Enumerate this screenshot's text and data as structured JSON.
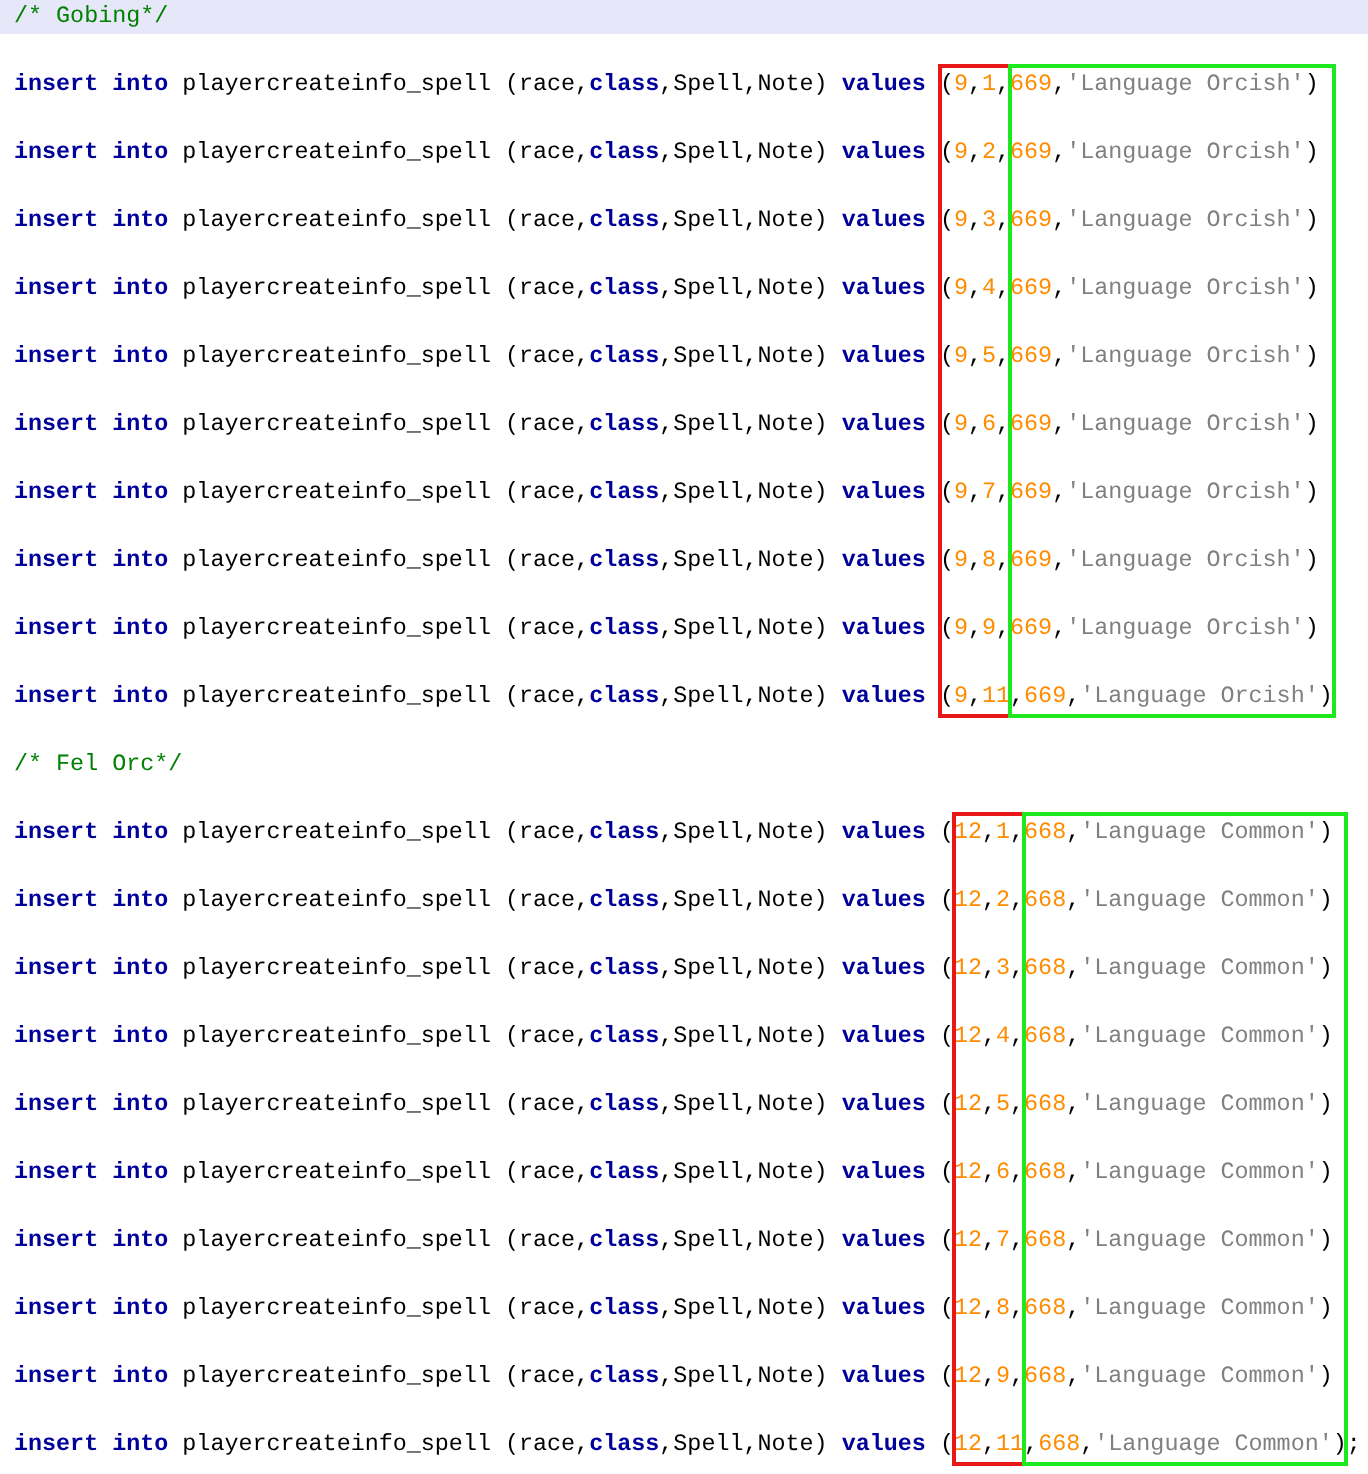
{
  "sections": [
    {
      "lines": [
        {
          "kind": "comment",
          "highlighted": true,
          "text": "/* Gobing*/"
        },
        {
          "kind": "statement",
          "highlighted": false,
          "tokens": [
            {
              "kind": "keyword",
              "text": "insert into"
            },
            {
              "kind": "plain",
              "text": " playercreateinfo_spell (race,"
            },
            {
              "kind": "keyword",
              "text": "class"
            },
            {
              "kind": "plain",
              "text": ",Spell,Note) "
            },
            {
              "kind": "keyword",
              "text": "values"
            },
            {
              "kind": "plain",
              "text": " ("
            },
            {
              "kind": "number",
              "text": "9"
            },
            {
              "kind": "plain",
              "text": ","
            },
            {
              "kind": "number",
              "text": "1"
            },
            {
              "kind": "plain",
              "text": ","
            },
            {
              "kind": "number",
              "text": "669"
            },
            {
              "kind": "plain",
              "text": ","
            },
            {
              "kind": "string",
              "text": "'Language Orcish'"
            },
            {
              "kind": "plain",
              "text": ")"
            }
          ]
        },
        {
          "kind": "statement",
          "highlighted": false,
          "tokens": [
            {
              "kind": "keyword",
              "text": "insert into"
            },
            {
              "kind": "plain",
              "text": " playercreateinfo_spell (race,"
            },
            {
              "kind": "keyword",
              "text": "class"
            },
            {
              "kind": "plain",
              "text": ",Spell,Note) "
            },
            {
              "kind": "keyword",
              "text": "values"
            },
            {
              "kind": "plain",
              "text": " ("
            },
            {
              "kind": "number",
              "text": "9"
            },
            {
              "kind": "plain",
              "text": ","
            },
            {
              "kind": "number",
              "text": "2"
            },
            {
              "kind": "plain",
              "text": ","
            },
            {
              "kind": "number",
              "text": "669"
            },
            {
              "kind": "plain",
              "text": ","
            },
            {
              "kind": "string",
              "text": "'Language Orcish'"
            },
            {
              "kind": "plain",
              "text": ")"
            }
          ]
        },
        {
          "kind": "statement",
          "highlighted": false,
          "tokens": [
            {
              "kind": "keyword",
              "text": "insert into"
            },
            {
              "kind": "plain",
              "text": " playercreateinfo_spell (race,"
            },
            {
              "kind": "keyword",
              "text": "class"
            },
            {
              "kind": "plain",
              "text": ",Spell,Note) "
            },
            {
              "kind": "keyword",
              "text": "values"
            },
            {
              "kind": "plain",
              "text": " ("
            },
            {
              "kind": "number",
              "text": "9"
            },
            {
              "kind": "plain",
              "text": ","
            },
            {
              "kind": "number",
              "text": "3"
            },
            {
              "kind": "plain",
              "text": ","
            },
            {
              "kind": "number",
              "text": "669"
            },
            {
              "kind": "plain",
              "text": ","
            },
            {
              "kind": "string",
              "text": "'Language Orcish'"
            },
            {
              "kind": "plain",
              "text": ")"
            }
          ]
        },
        {
          "kind": "statement",
          "highlighted": false,
          "tokens": [
            {
              "kind": "keyword",
              "text": "insert into"
            },
            {
              "kind": "plain",
              "text": " playercreateinfo_spell (race,"
            },
            {
              "kind": "keyword",
              "text": "class"
            },
            {
              "kind": "plain",
              "text": ",Spell,Note) "
            },
            {
              "kind": "keyword",
              "text": "values"
            },
            {
              "kind": "plain",
              "text": " ("
            },
            {
              "kind": "number",
              "text": "9"
            },
            {
              "kind": "plain",
              "text": ","
            },
            {
              "kind": "number",
              "text": "4"
            },
            {
              "kind": "plain",
              "text": ","
            },
            {
              "kind": "number",
              "text": "669"
            },
            {
              "kind": "plain",
              "text": ","
            },
            {
              "kind": "string",
              "text": "'Language Orcish'"
            },
            {
              "kind": "plain",
              "text": ")"
            }
          ]
        },
        {
          "kind": "statement",
          "highlighted": false,
          "tokens": [
            {
              "kind": "keyword",
              "text": "insert into"
            },
            {
              "kind": "plain",
              "text": " playercreateinfo_spell (race,"
            },
            {
              "kind": "keyword",
              "text": "class"
            },
            {
              "kind": "plain",
              "text": ",Spell,Note) "
            },
            {
              "kind": "keyword",
              "text": "values"
            },
            {
              "kind": "plain",
              "text": " ("
            },
            {
              "kind": "number",
              "text": "9"
            },
            {
              "kind": "plain",
              "text": ","
            },
            {
              "kind": "number",
              "text": "5"
            },
            {
              "kind": "plain",
              "text": ","
            },
            {
              "kind": "number",
              "text": "669"
            },
            {
              "kind": "plain",
              "text": ","
            },
            {
              "kind": "string",
              "text": "'Language Orcish'"
            },
            {
              "kind": "plain",
              "text": ")"
            }
          ]
        },
        {
          "kind": "statement",
          "highlighted": false,
          "tokens": [
            {
              "kind": "keyword",
              "text": "insert into"
            },
            {
              "kind": "plain",
              "text": " playercreateinfo_spell (race,"
            },
            {
              "kind": "keyword",
              "text": "class"
            },
            {
              "kind": "plain",
              "text": ",Spell,Note) "
            },
            {
              "kind": "keyword",
              "text": "values"
            },
            {
              "kind": "plain",
              "text": " ("
            },
            {
              "kind": "number",
              "text": "9"
            },
            {
              "kind": "plain",
              "text": ","
            },
            {
              "kind": "number",
              "text": "6"
            },
            {
              "kind": "plain",
              "text": ","
            },
            {
              "kind": "number",
              "text": "669"
            },
            {
              "kind": "plain",
              "text": ","
            },
            {
              "kind": "string",
              "text": "'Language Orcish'"
            },
            {
              "kind": "plain",
              "text": ")"
            }
          ]
        },
        {
          "kind": "statement",
          "highlighted": false,
          "tokens": [
            {
              "kind": "keyword",
              "text": "insert into"
            },
            {
              "kind": "plain",
              "text": " playercreateinfo_spell (race,"
            },
            {
              "kind": "keyword",
              "text": "class"
            },
            {
              "kind": "plain",
              "text": ",Spell,Note) "
            },
            {
              "kind": "keyword",
              "text": "values"
            },
            {
              "kind": "plain",
              "text": " ("
            },
            {
              "kind": "number",
              "text": "9"
            },
            {
              "kind": "plain",
              "text": ","
            },
            {
              "kind": "number",
              "text": "7"
            },
            {
              "kind": "plain",
              "text": ","
            },
            {
              "kind": "number",
              "text": "669"
            },
            {
              "kind": "plain",
              "text": ","
            },
            {
              "kind": "string",
              "text": "'Language Orcish'"
            },
            {
              "kind": "plain",
              "text": ")"
            }
          ]
        },
        {
          "kind": "statement",
          "highlighted": false,
          "tokens": [
            {
              "kind": "keyword",
              "text": "insert into"
            },
            {
              "kind": "plain",
              "text": " playercreateinfo_spell (race,"
            },
            {
              "kind": "keyword",
              "text": "class"
            },
            {
              "kind": "plain",
              "text": ",Spell,Note) "
            },
            {
              "kind": "keyword",
              "text": "values"
            },
            {
              "kind": "plain",
              "text": " ("
            },
            {
              "kind": "number",
              "text": "9"
            },
            {
              "kind": "plain",
              "text": ","
            },
            {
              "kind": "number",
              "text": "8"
            },
            {
              "kind": "plain",
              "text": ","
            },
            {
              "kind": "number",
              "text": "669"
            },
            {
              "kind": "plain",
              "text": ","
            },
            {
              "kind": "string",
              "text": "'Language Orcish'"
            },
            {
              "kind": "plain",
              "text": ")"
            }
          ]
        },
        {
          "kind": "statement",
          "highlighted": false,
          "tokens": [
            {
              "kind": "keyword",
              "text": "insert into"
            },
            {
              "kind": "plain",
              "text": " playercreateinfo_spell (race,"
            },
            {
              "kind": "keyword",
              "text": "class"
            },
            {
              "kind": "plain",
              "text": ",Spell,Note) "
            },
            {
              "kind": "keyword",
              "text": "values"
            },
            {
              "kind": "plain",
              "text": " ("
            },
            {
              "kind": "number",
              "text": "9"
            },
            {
              "kind": "plain",
              "text": ","
            },
            {
              "kind": "number",
              "text": "9"
            },
            {
              "kind": "plain",
              "text": ","
            },
            {
              "kind": "number",
              "text": "669"
            },
            {
              "kind": "plain",
              "text": ","
            },
            {
              "kind": "string",
              "text": "'Language Orcish'"
            },
            {
              "kind": "plain",
              "text": ")"
            }
          ]
        },
        {
          "kind": "statement",
          "highlighted": false,
          "tokens": [
            {
              "kind": "keyword",
              "text": "insert into"
            },
            {
              "kind": "plain",
              "text": " playercreateinfo_spell (race,"
            },
            {
              "kind": "keyword",
              "text": "class"
            },
            {
              "kind": "plain",
              "text": ",Spell,Note) "
            },
            {
              "kind": "keyword",
              "text": "values"
            },
            {
              "kind": "plain",
              "text": " ("
            },
            {
              "kind": "number",
              "text": "9"
            },
            {
              "kind": "plain",
              "text": ","
            },
            {
              "kind": "number",
              "text": "11"
            },
            {
              "kind": "plain",
              "text": ","
            },
            {
              "kind": "number",
              "text": "669"
            },
            {
              "kind": "plain",
              "text": ","
            },
            {
              "kind": "string",
              "text": "'Language Orcish'"
            },
            {
              "kind": "plain",
              "text": ")"
            }
          ]
        }
      ],
      "boxes": [
        {
          "color": "#e81818"
        },
        {
          "color": "#1ee81e"
        }
      ]
    },
    {
      "lines": [
        {
          "kind": "comment",
          "highlighted": false,
          "text": "/* Fel Orc*/"
        },
        {
          "kind": "statement",
          "highlighted": false,
          "tokens": [
            {
              "kind": "keyword",
              "text": "insert into"
            },
            {
              "kind": "plain",
              "text": " playercreateinfo_spell (race,"
            },
            {
              "kind": "keyword",
              "text": "class"
            },
            {
              "kind": "plain",
              "text": ",Spell,Note) "
            },
            {
              "kind": "keyword",
              "text": "values"
            },
            {
              "kind": "plain",
              "text": " ("
            },
            {
              "kind": "number",
              "text": "12"
            },
            {
              "kind": "plain",
              "text": ","
            },
            {
              "kind": "number",
              "text": "1"
            },
            {
              "kind": "plain",
              "text": ","
            },
            {
              "kind": "number",
              "text": "668"
            },
            {
              "kind": "plain",
              "text": ","
            },
            {
              "kind": "string",
              "text": "'Language Common'"
            },
            {
              "kind": "plain",
              "text": ")"
            }
          ]
        },
        {
          "kind": "statement",
          "highlighted": false,
          "tokens": [
            {
              "kind": "keyword",
              "text": "insert into"
            },
            {
              "kind": "plain",
              "text": " playercreateinfo_spell (race,"
            },
            {
              "kind": "keyword",
              "text": "class"
            },
            {
              "kind": "plain",
              "text": ",Spell,Note) "
            },
            {
              "kind": "keyword",
              "text": "values"
            },
            {
              "kind": "plain",
              "text": " ("
            },
            {
              "kind": "number",
              "text": "12"
            },
            {
              "kind": "plain",
              "text": ","
            },
            {
              "kind": "number",
              "text": "2"
            },
            {
              "kind": "plain",
              "text": ","
            },
            {
              "kind": "number",
              "text": "668"
            },
            {
              "kind": "plain",
              "text": ","
            },
            {
              "kind": "string",
              "text": "'Language Common'"
            },
            {
              "kind": "plain",
              "text": ")"
            }
          ]
        },
        {
          "kind": "statement",
          "highlighted": false,
          "tokens": [
            {
              "kind": "keyword",
              "text": "insert into"
            },
            {
              "kind": "plain",
              "text": " playercreateinfo_spell (race,"
            },
            {
              "kind": "keyword",
              "text": "class"
            },
            {
              "kind": "plain",
              "text": ",Spell,Note) "
            },
            {
              "kind": "keyword",
              "text": "values"
            },
            {
              "kind": "plain",
              "text": " ("
            },
            {
              "kind": "number",
              "text": "12"
            },
            {
              "kind": "plain",
              "text": ","
            },
            {
              "kind": "number",
              "text": "3"
            },
            {
              "kind": "plain",
              "text": ","
            },
            {
              "kind": "number",
              "text": "668"
            },
            {
              "kind": "plain",
              "text": ","
            },
            {
              "kind": "string",
              "text": "'Language Common'"
            },
            {
              "kind": "plain",
              "text": ")"
            }
          ]
        },
        {
          "kind": "statement",
          "highlighted": false,
          "tokens": [
            {
              "kind": "keyword",
              "text": "insert into"
            },
            {
              "kind": "plain",
              "text": " playercreateinfo_spell (race,"
            },
            {
              "kind": "keyword",
              "text": "class"
            },
            {
              "kind": "plain",
              "text": ",Spell,Note) "
            },
            {
              "kind": "keyword",
              "text": "values"
            },
            {
              "kind": "plain",
              "text": " ("
            },
            {
              "kind": "number",
              "text": "12"
            },
            {
              "kind": "plain",
              "text": ","
            },
            {
              "kind": "number",
              "text": "4"
            },
            {
              "kind": "plain",
              "text": ","
            },
            {
              "kind": "number",
              "text": "668"
            },
            {
              "kind": "plain",
              "text": ","
            },
            {
              "kind": "string",
              "text": "'Language Common'"
            },
            {
              "kind": "plain",
              "text": ")"
            }
          ]
        },
        {
          "kind": "statement",
          "highlighted": false,
          "tokens": [
            {
              "kind": "keyword",
              "text": "insert into"
            },
            {
              "kind": "plain",
              "text": " playercreateinfo_spell (race,"
            },
            {
              "kind": "keyword",
              "text": "class"
            },
            {
              "kind": "plain",
              "text": ",Spell,Note) "
            },
            {
              "kind": "keyword",
              "text": "values"
            },
            {
              "kind": "plain",
              "text": " ("
            },
            {
              "kind": "number",
              "text": "12"
            },
            {
              "kind": "plain",
              "text": ","
            },
            {
              "kind": "number",
              "text": "5"
            },
            {
              "kind": "plain",
              "text": ","
            },
            {
              "kind": "number",
              "text": "668"
            },
            {
              "kind": "plain",
              "text": ","
            },
            {
              "kind": "string",
              "text": "'Language Common'"
            },
            {
              "kind": "plain",
              "text": ")"
            }
          ]
        },
        {
          "kind": "statement",
          "highlighted": false,
          "tokens": [
            {
              "kind": "keyword",
              "text": "insert into"
            },
            {
              "kind": "plain",
              "text": " playercreateinfo_spell (race,"
            },
            {
              "kind": "keyword",
              "text": "class"
            },
            {
              "kind": "plain",
              "text": ",Spell,Note) "
            },
            {
              "kind": "keyword",
              "text": "values"
            },
            {
              "kind": "plain",
              "text": " ("
            },
            {
              "kind": "number",
              "text": "12"
            },
            {
              "kind": "plain",
              "text": ","
            },
            {
              "kind": "number",
              "text": "6"
            },
            {
              "kind": "plain",
              "text": ","
            },
            {
              "kind": "number",
              "text": "668"
            },
            {
              "kind": "plain",
              "text": ","
            },
            {
              "kind": "string",
              "text": "'Language Common'"
            },
            {
              "kind": "plain",
              "text": ")"
            }
          ]
        },
        {
          "kind": "statement",
          "highlighted": false,
          "tokens": [
            {
              "kind": "keyword",
              "text": "insert into"
            },
            {
              "kind": "plain",
              "text": " playercreateinfo_spell (race,"
            },
            {
              "kind": "keyword",
              "text": "class"
            },
            {
              "kind": "plain",
              "text": ",Spell,Note) "
            },
            {
              "kind": "keyword",
              "text": "values"
            },
            {
              "kind": "plain",
              "text": " ("
            },
            {
              "kind": "number",
              "text": "12"
            },
            {
              "kind": "plain",
              "text": ","
            },
            {
              "kind": "number",
              "text": "7"
            },
            {
              "kind": "plain",
              "text": ","
            },
            {
              "kind": "number",
              "text": "668"
            },
            {
              "kind": "plain",
              "text": ","
            },
            {
              "kind": "string",
              "text": "'Language Common'"
            },
            {
              "kind": "plain",
              "text": ")"
            }
          ]
        },
        {
          "kind": "statement",
          "highlighted": false,
          "tokens": [
            {
              "kind": "keyword",
              "text": "insert into"
            },
            {
              "kind": "plain",
              "text": " playercreateinfo_spell (race,"
            },
            {
              "kind": "keyword",
              "text": "class"
            },
            {
              "kind": "plain",
              "text": ",Spell,Note) "
            },
            {
              "kind": "keyword",
              "text": "values"
            },
            {
              "kind": "plain",
              "text": " ("
            },
            {
              "kind": "number",
              "text": "12"
            },
            {
              "kind": "plain",
              "text": ","
            },
            {
              "kind": "number",
              "text": "8"
            },
            {
              "kind": "plain",
              "text": ","
            },
            {
              "kind": "number",
              "text": "668"
            },
            {
              "kind": "plain",
              "text": ","
            },
            {
              "kind": "string",
              "text": "'Language Common'"
            },
            {
              "kind": "plain",
              "text": ")"
            }
          ]
        },
        {
          "kind": "statement",
          "highlighted": false,
          "tokens": [
            {
              "kind": "keyword",
              "text": "insert into"
            },
            {
              "kind": "plain",
              "text": " playercreateinfo_spell (race,"
            },
            {
              "kind": "keyword",
              "text": "class"
            },
            {
              "kind": "plain",
              "text": ",Spell,Note) "
            },
            {
              "kind": "keyword",
              "text": "values"
            },
            {
              "kind": "plain",
              "text": " ("
            },
            {
              "kind": "number",
              "text": "12"
            },
            {
              "kind": "plain",
              "text": ","
            },
            {
              "kind": "number",
              "text": "9"
            },
            {
              "kind": "plain",
              "text": ","
            },
            {
              "kind": "number",
              "text": "668"
            },
            {
              "kind": "plain",
              "text": ","
            },
            {
              "kind": "string",
              "text": "'Language Common'"
            },
            {
              "kind": "plain",
              "text": ")"
            }
          ]
        },
        {
          "kind": "statement",
          "highlighted": false,
          "tokens": [
            {
              "kind": "keyword",
              "text": "insert into"
            },
            {
              "kind": "plain",
              "text": " playercreateinfo_spell (race,"
            },
            {
              "kind": "keyword",
              "text": "class"
            },
            {
              "kind": "plain",
              "text": ",Spell,Note) "
            },
            {
              "kind": "keyword",
              "text": "values"
            },
            {
              "kind": "plain",
              "text": " ("
            },
            {
              "kind": "number",
              "text": "12"
            },
            {
              "kind": "plain",
              "text": ","
            },
            {
              "kind": "number",
              "text": "11"
            },
            {
              "kind": "plain",
              "text": ","
            },
            {
              "kind": "number",
              "text": "668"
            },
            {
              "kind": "plain",
              "text": ","
            },
            {
              "kind": "string",
              "text": "'Language Common'"
            },
            {
              "kind": "plain",
              "text": ");"
            }
          ]
        }
      ],
      "boxes": [
        {
          "color": "#e81818"
        },
        {
          "color": "#1ee81e"
        }
      ]
    }
  ]
}
